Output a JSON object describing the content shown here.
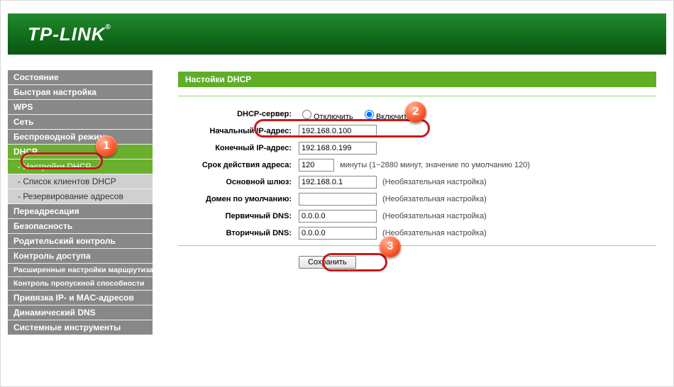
{
  "brand": "TP-LINK",
  "sidebar": {
    "items": [
      {
        "label": "Состояние",
        "type": "top"
      },
      {
        "label": "Быстрая настройка",
        "type": "top"
      },
      {
        "label": "WPS",
        "type": "top"
      },
      {
        "label": "Сеть",
        "type": "top"
      },
      {
        "label": "Беспроводной режим",
        "type": "top"
      },
      {
        "label": "DHCP",
        "type": "top",
        "active": true
      },
      {
        "label": "- Настройки DHCP",
        "type": "sub",
        "active": true
      },
      {
        "label": "- Список клиентов DHCP",
        "type": "sub"
      },
      {
        "label": "- Резервирование адресов",
        "type": "sub"
      },
      {
        "label": "Переадресация",
        "type": "top"
      },
      {
        "label": "Безопасность",
        "type": "top"
      },
      {
        "label": "Родительский контроль",
        "type": "top"
      },
      {
        "label": "Контроль доступа",
        "type": "top"
      },
      {
        "label": "Расширенные настройки маршрутизации",
        "type": "top"
      },
      {
        "label": "Контроль пропускной способности",
        "type": "top"
      },
      {
        "label": "Привязка IP- и MAC-адресов",
        "type": "top"
      },
      {
        "label": "Динамический DNS",
        "type": "top"
      },
      {
        "label": "Системные инструменты",
        "type": "top"
      }
    ]
  },
  "panel": {
    "title": "Настойки DHCP",
    "dhcp_server_label": "DHCP-сервер:",
    "radio_off": "Отключить",
    "radio_on": "Включить",
    "start_ip_label": "Начальный IP-адрес:",
    "start_ip_value": "192.168.0.100",
    "end_ip_label": "Конечный IP-адрес:",
    "end_ip_value": "192.168.0.199",
    "lease_label": "Срок действия адреса:",
    "lease_value": "120",
    "lease_hint": "минуты (1~2880 минут, значение по умолчанию 120)",
    "gateway_label": "Основной шлюз:",
    "gateway_value": "192.168.0.1",
    "optional_hint": "(Необязательная настройка)",
    "domain_label": "Домен по умолчанию:",
    "domain_value": "",
    "dns1_label": "Первичный DNS:",
    "dns1_value": "0.0.0.0",
    "dns2_label": "Вторичный DNS:",
    "dns2_value": "0.0.0.0",
    "save_button": "Сохранить"
  },
  "annotations": {
    "n1": "1",
    "n2": "2",
    "n3": "3"
  }
}
